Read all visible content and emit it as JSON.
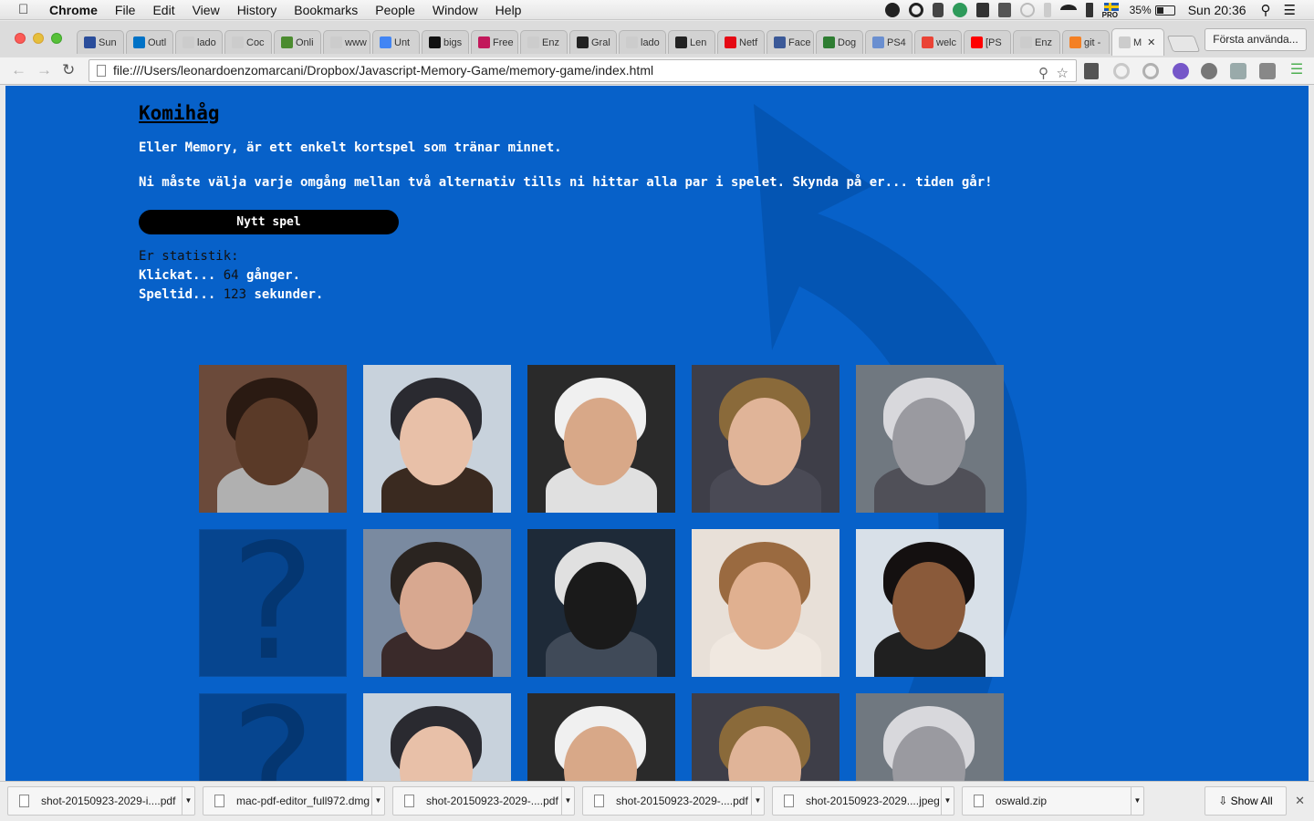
{
  "menubar": {
    "app": "Chrome",
    "items": [
      "File",
      "Edit",
      "View",
      "History",
      "Bookmarks",
      "People",
      "Window",
      "Help"
    ],
    "battery": "35%",
    "clock": "Sun 20:36",
    "flag_label": "PRO"
  },
  "tabs": [
    {
      "label": "Sun",
      "color": "#2a4d9b"
    },
    {
      "label": "Outl",
      "color": "#0072c6"
    },
    {
      "label": "lado",
      "color": "#cccccc"
    },
    {
      "label": "Coc",
      "color": "#cccccc"
    },
    {
      "label": "Onli",
      "color": "#4b8b2f"
    },
    {
      "label": "www",
      "color": "#cccccc"
    },
    {
      "label": "Unt",
      "color": "#4285f4"
    },
    {
      "label": "bigs",
      "color": "#111111"
    },
    {
      "label": "Free",
      "color": "#c2185b"
    },
    {
      "label": "Enz",
      "color": "#cccccc"
    },
    {
      "label": "Gral",
      "color": "#222222"
    },
    {
      "label": "lado",
      "color": "#cccccc"
    },
    {
      "label": "Len",
      "color": "#222222"
    },
    {
      "label": "Netf",
      "color": "#e50914"
    },
    {
      "label": "Face",
      "color": "#3b5998"
    },
    {
      "label": "Dog",
      "color": "#2e7d32"
    },
    {
      "label": "PS4",
      "color": "#6a8fd0"
    },
    {
      "label": "welc",
      "color": "#ea4335"
    },
    {
      "label": "[PS",
      "color": "#ff0000"
    },
    {
      "label": "Enz",
      "color": "#cccccc"
    },
    {
      "label": "git -",
      "color": "#f48024"
    },
    {
      "label": "M",
      "color": "#cccccc"
    }
  ],
  "profile_button": "Första använda...",
  "address": "file:///Users/leonardoenzomarcani/Dropbox/Javascript-Memory-Game/memory-game/index.html",
  "page": {
    "title": "Komihåg",
    "intro": "Eller Memory, är ett enkelt kortspel som tränar minnet.",
    "instructions": "Ni måste välja varje omgång mellan två alternativ tills ni hittar alla par i spelet. Skynda på er... tiden går!",
    "new_game": "Nytt spel",
    "stats_heading": "Er statistik:",
    "clicks_prefix": "Klickat...",
    "clicks": "64",
    "clicks_suffix": "gånger.",
    "time_prefix": "Speltid...",
    "time": "123",
    "time_suffix": "sekunder.",
    "hidden_card_symbol": "?",
    "cards": [
      {
        "state": "face",
        "bg": "#6b4a3a",
        "skin": "#5a3a28",
        "hair": "#2a1a12",
        "accent": "#b0b0b0"
      },
      {
        "state": "face",
        "bg": "#c8d2dc",
        "skin": "#e8c0a8",
        "hair": "#2a2a30",
        "accent": "#3a2a20"
      },
      {
        "state": "face",
        "bg": "#2a2a2a",
        "skin": "#d8a888",
        "hair": "#f0f0f0",
        "accent": "#e0e0e0"
      },
      {
        "state": "face",
        "bg": "#3e3e48",
        "skin": "#e0b498",
        "hair": "#8a6a3a",
        "accent": "#4a4a55"
      },
      {
        "state": "face",
        "bg": "#707880",
        "skin": "#9a9aa0",
        "hair": "#d8d8dc",
        "accent": "#505058"
      },
      {
        "state": "hidden"
      },
      {
        "state": "face",
        "bg": "#7a8aa0",
        "skin": "#d8a890",
        "hair": "#2a2420",
        "accent": "#3a2a2a"
      },
      {
        "state": "face",
        "bg": "#1e2a38",
        "skin": "#1a1a1a",
        "hair": "#e0e0e0",
        "accent": "#404a58"
      },
      {
        "state": "face",
        "bg": "#e8e0d8",
        "skin": "#e0b090",
        "hair": "#9a6a40",
        "accent": "#f0e8e0"
      },
      {
        "state": "face",
        "bg": "#d8e0e8",
        "skin": "#8a5a3a",
        "hair": "#141010",
        "accent": "#202020"
      },
      {
        "state": "hidden"
      },
      {
        "state": "face",
        "bg": "#c8d2dc",
        "skin": "#e8c0a8",
        "hair": "#2a2a30",
        "accent": "#3a2a20"
      },
      {
        "state": "face",
        "bg": "#2a2a2a",
        "skin": "#d8a888",
        "hair": "#f0f0f0",
        "accent": "#e0e0e0"
      },
      {
        "state": "face",
        "bg": "#3e3e48",
        "skin": "#e0b498",
        "hair": "#8a6a3a",
        "accent": "#4a4a55"
      },
      {
        "state": "face",
        "bg": "#707880",
        "skin": "#9a9aa0",
        "hair": "#d8d8dc",
        "accent": "#505058"
      }
    ]
  },
  "downloads": {
    "items": [
      {
        "name": "shot-20150923-2029-i....pdf"
      },
      {
        "name": "mac-pdf-editor_full972.dmg"
      },
      {
        "name": "shot-20150923-2029-....pdf"
      },
      {
        "name": "shot-20150923-2029-....pdf"
      },
      {
        "name": "shot-20150923-2029....jpeg"
      },
      {
        "name": "oswald.zip"
      }
    ],
    "show_all": "Show All"
  },
  "colors": {
    "page_bg": "#0761c9",
    "hidden_card": "#06458f"
  }
}
